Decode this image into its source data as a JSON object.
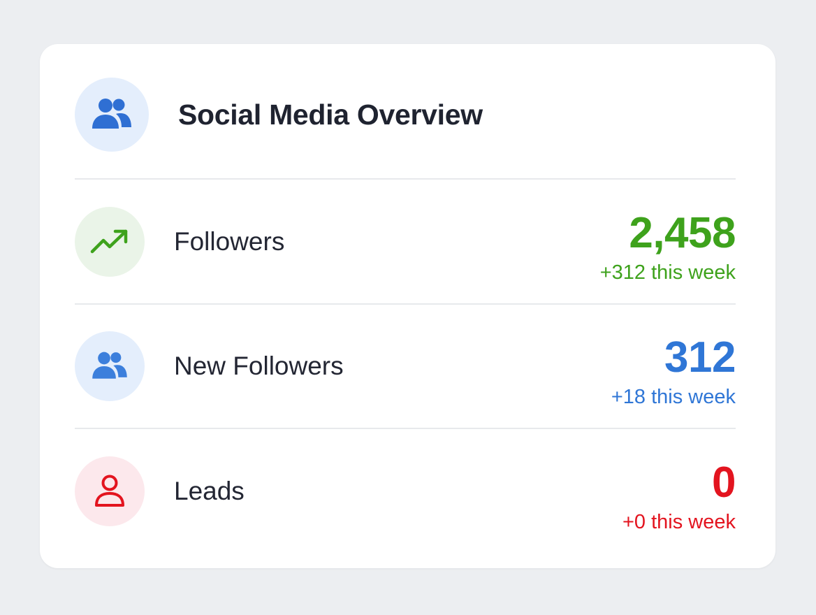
{
  "card": {
    "title": "Social Media Overview",
    "header_icon": "users-icon"
  },
  "rows": [
    {
      "label": "Followers",
      "value": "2,458",
      "delta": "+312 this week",
      "icon": "trending-up-icon",
      "color": "#3ea21c",
      "icon_bg": "#eaf4e8"
    },
    {
      "label": "New Followers",
      "value": "312",
      "delta": "+18 this week",
      "icon": "users-icon",
      "color": "#2f76d6",
      "icon_bg": "#e4eefc"
    },
    {
      "label": "Leads",
      "value": "0",
      "delta": "+0 this week",
      "icon": "user-icon",
      "color": "#e3141f",
      "icon_bg": "#fce8ec"
    }
  ],
  "colors": {
    "page_bg": "#eceef1",
    "card_bg": "#ffffff",
    "header_icon_bg": "#e4eefc",
    "header_icon_fg": "#2f6fd3",
    "title": "#1f2330"
  }
}
